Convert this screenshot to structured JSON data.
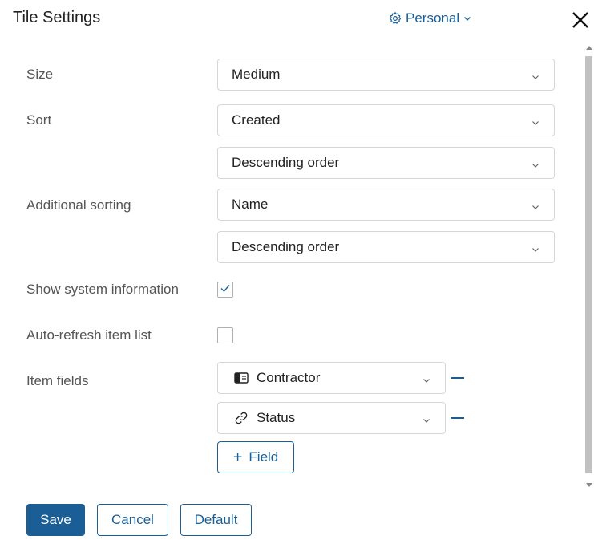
{
  "header": {
    "title": "Tile Settings",
    "scope_label": "Personal"
  },
  "form": {
    "size": {
      "label": "Size",
      "value": "Medium"
    },
    "sort": {
      "label": "Sort",
      "field_value": "Created",
      "order_value": "Descending order"
    },
    "additional_sorting": {
      "label": "Additional sorting",
      "field_value": "Name",
      "order_value": "Descending order"
    },
    "show_system_info": {
      "label": "Show system information",
      "checked": true
    },
    "auto_refresh": {
      "label": "Auto-refresh item list",
      "checked": false
    },
    "item_fields": {
      "label": "Item fields",
      "items": [
        {
          "name": "Contractor",
          "icon": "document-card-icon"
        },
        {
          "name": "Status",
          "icon": "link-icon"
        }
      ],
      "add_label": "Field"
    }
  },
  "footer": {
    "save_label": "Save",
    "cancel_label": "Cancel",
    "default_label": "Default"
  },
  "colors": {
    "accent": "#1b5e96",
    "border": "#d3d7db",
    "label": "#555555"
  }
}
